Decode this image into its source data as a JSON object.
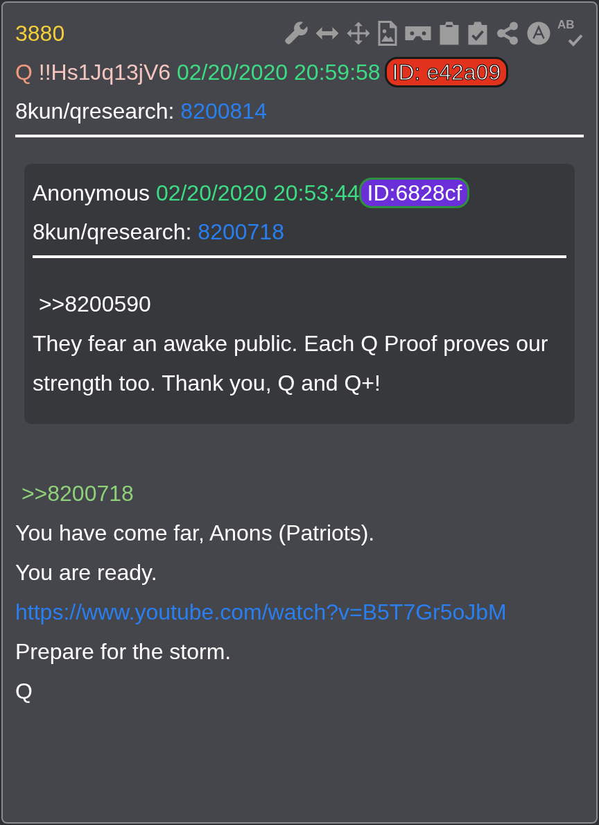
{
  "post": {
    "number": "3880",
    "author": "Q",
    "tripcode": "!!Hs1Jq13jV6",
    "date": "02/20/2020 20:59:58",
    "id": {
      "label": "ID: e42a09",
      "color": "#e0321c"
    },
    "board": "8kun/qresearch:",
    "post_no": "8200814"
  },
  "toolbar": {
    "spellcheck_text": "AB"
  },
  "quote": {
    "author": "Anonymous",
    "date": "02/20/2020 20:53:44",
    "id": {
      "label": "ID:6828cf",
      "color": "#6b2fd9"
    },
    "board": "8kun/qresearch:",
    "post_no": "8200718",
    "lines": [
      {
        "kind": "ref",
        "text": " >>8200590"
      },
      {
        "kind": "text",
        "text": "They fear an awake public. Each Q Proof proves our strength too. Thank you, Q and Q+!"
      }
    ]
  },
  "lines": [
    {
      "kind": "ref",
      "text": " >>8200718"
    },
    {
      "kind": "text",
      "text": "You have come far, Anons (Patriots)."
    },
    {
      "kind": "text",
      "text": "You are ready."
    },
    {
      "kind": "link",
      "text": "https://www.youtube.com/watch?v=B5T7Gr5oJbM"
    },
    {
      "kind": "text",
      "text": "Prepare for the storm."
    },
    {
      "kind": "text",
      "text": "Q"
    }
  ]
}
